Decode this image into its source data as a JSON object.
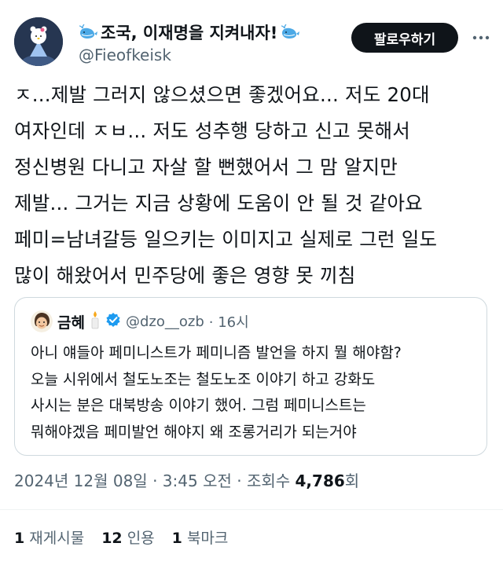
{
  "author": {
    "display_name": "조국, 이재명을 지켜내자!",
    "handle": "@Fieofkeisk",
    "name_icon": "whale-emoji-icon"
  },
  "follow_button": {
    "label": "팔로우하기"
  },
  "more_button": {
    "icon": "more-dots-icon"
  },
  "tweet": {
    "lines": [
      "ㅈ...제발 그러지 않으셨으면 좋겠어요... 저도 20대",
      "여자인데 ㅈㅂ... 저도 성추행 당하고 신고 못해서",
      "정신병원 다니고 자살 할 뻔했어서 그 맘 알지만",
      "제발... 그거는 지금 상황에 도움이 안 될 것 같아요",
      "페미=남녀갈등 일으키는 이미지고 실제로 그런 일도",
      "많이 해왔어서 민주당에 좋은 영향 못 끼침"
    ]
  },
  "quote": {
    "name": "금혜",
    "name_icon": "candle-emoji-icon",
    "verified_icon": "verified-badge-icon",
    "handle": "@dzo__ozb",
    "time": "· 16시",
    "lines": [
      "아니 얘들아 페미니스트가 페미니즘 발언을 하지 뭘 해야함?",
      "오늘 시위에서 철도노조는 철도노조 이야기 하고 강화도",
      "사시는 분은 대북방송 이야기 했어. 그럼 페미니스트는",
      "뭐해야겠음 페미발언 해야지 왜 조롱거리가 되는거야"
    ]
  },
  "meta": {
    "date": "2024년 12월 08일",
    "time": "3:45 오전",
    "views_label": "조회수",
    "views_count": "4,786",
    "views_suffix": "회"
  },
  "stats": {
    "reposts": {
      "count": "1",
      "label": "재게시물"
    },
    "quotes": {
      "count": "12",
      "label": "인용"
    },
    "bookmarks": {
      "count": "1",
      "label": "북마크"
    }
  },
  "colors": {
    "text": "#0f1419",
    "secondary": "#536471",
    "border": "#cfd9de",
    "verified": "#1d9bf0",
    "button_bg": "#0f1419"
  }
}
